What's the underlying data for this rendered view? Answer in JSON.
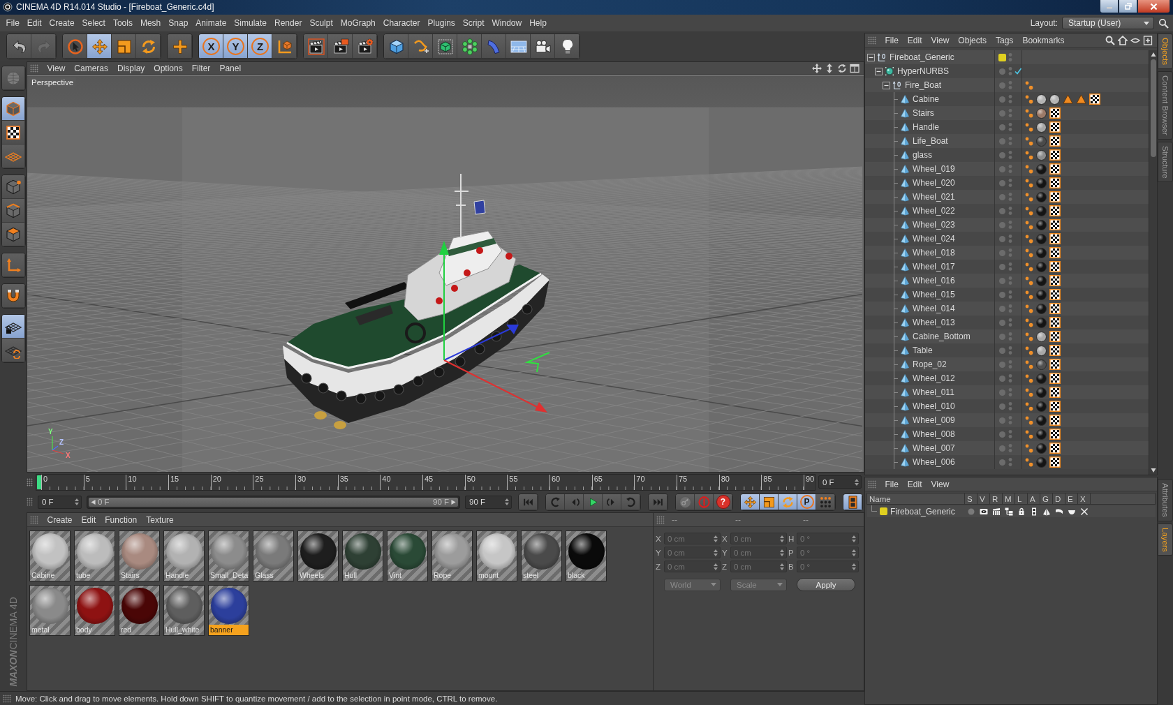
{
  "window": {
    "title": "CINEMA 4D R14.014 Studio - [Fireboat_Generic.c4d]"
  },
  "menu_bar": [
    "File",
    "Edit",
    "Create",
    "Select",
    "Tools",
    "Mesh",
    "Snap",
    "Animate",
    "Simulate",
    "Render",
    "Sculpt",
    "MoGraph",
    "Character",
    "Plugins",
    "Script",
    "Window",
    "Help"
  ],
  "layout": {
    "label": "Layout:",
    "value": "Startup (User)"
  },
  "toolbar": [
    [
      {
        "kind": "undo",
        "on": false
      },
      {
        "kind": "redo",
        "on": false
      }
    ],
    [
      {
        "kind": "select",
        "on": false
      },
      {
        "kind": "move",
        "on": true
      },
      {
        "kind": "scale",
        "on": false
      },
      {
        "kind": "rotate",
        "on": false
      }
    ],
    [
      {
        "kind": "add",
        "on": false
      }
    ],
    [
      {
        "kind": "axis",
        "label": "X",
        "on": true
      },
      {
        "kind": "axis",
        "label": "Y",
        "on": true
      },
      {
        "kind": "axis",
        "label": "Z",
        "on": true
      },
      {
        "kind": "coords",
        "on": false
      }
    ],
    [
      {
        "kind": "render_view",
        "on": false
      },
      {
        "kind": "render_pv",
        "on": false
      },
      {
        "kind": "render_settings",
        "on": false
      }
    ],
    [
      {
        "kind": "cube",
        "on": false
      },
      {
        "kind": "pen",
        "on": false
      },
      {
        "kind": "subdiv",
        "on": false
      },
      {
        "kind": "cloner",
        "on": false
      },
      {
        "kind": "deformer",
        "on": false
      },
      {
        "kind": "floor",
        "on": false
      },
      {
        "kind": "camera",
        "on": false
      },
      {
        "kind": "light",
        "on": false
      }
    ]
  ],
  "mode_toolbar": [
    [
      {
        "kind": "editable",
        "on": false
      }
    ],
    [
      {
        "kind": "model",
        "on": true
      },
      {
        "kind": "texture",
        "on": false
      },
      {
        "kind": "workplane",
        "on": false
      }
    ],
    [
      {
        "kind": "points",
        "on": false
      },
      {
        "kind": "edges",
        "on": false
      },
      {
        "kind": "polygons",
        "on": false
      }
    ],
    [
      {
        "kind": "axis_mode",
        "on": false
      }
    ],
    [
      {
        "kind": "snap",
        "on": false
      }
    ],
    [
      {
        "kind": "wp_lock",
        "on": true
      },
      {
        "kind": "wp_rotate",
        "on": false
      }
    ]
  ],
  "logo": {
    "brand": "MAXON",
    "product": "CINEMA 4D"
  },
  "viewport": {
    "menu": [
      "View",
      "Cameras",
      "Display",
      "Options",
      "Filter",
      "Panel"
    ],
    "camera": "Perspective",
    "axis_labels": [
      "Y",
      "X",
      "Z"
    ]
  },
  "timeline": {
    "ticks": [
      "0",
      "5",
      "10",
      "15",
      "20",
      "25",
      "30",
      "35",
      "40",
      "45",
      "50",
      "55",
      "60",
      "65",
      "70",
      "75",
      "80",
      "85",
      "90"
    ],
    "level": 0,
    "current_frame": "0 F",
    "start": "0 F",
    "range": {
      "start": "0 F",
      "end": "90 F",
      "level": 1
    },
    "end": "90 F"
  },
  "transport": [
    [
      {
        "kind": "to_start",
        "on": false
      }
    ],
    [
      {
        "kind": "prev_key",
        "on": false
      },
      {
        "kind": "step_back",
        "on": false
      },
      {
        "kind": "play",
        "on": false
      },
      {
        "kind": "step_forward",
        "on": false
      },
      {
        "kind": "next_key",
        "on": false
      }
    ],
    [
      {
        "kind": "to_end",
        "on": false
      }
    ],
    [
      {
        "kind": "key",
        "on": false
      },
      {
        "kind": "record",
        "on": false
      },
      {
        "kind": "question",
        "label": "?",
        "on": false
      }
    ],
    [
      {
        "kind": "move",
        "on": true
      },
      {
        "kind": "scale",
        "on": true
      },
      {
        "kind": "rotate",
        "on": true
      },
      {
        "kind": "param",
        "label": "P",
        "on": true
      },
      {
        "kind": "points_grid",
        "on": false
      }
    ],
    [
      {
        "kind": "film",
        "on": true
      }
    ]
  ],
  "materials": {
    "menu": [
      "Create",
      "Edit",
      "Function",
      "Texture"
    ],
    "items": [
      {
        "name": "Cabine",
        "color": "#c2c2c2",
        "selected": false
      },
      {
        "name": "tube",
        "color": "#bcbcbc",
        "selected": false
      },
      {
        "name": "Stairs",
        "color": "#a98a80",
        "selected": false
      },
      {
        "name": "Handle",
        "color": "#b2b2b2",
        "selected": false
      },
      {
        "name": "Small_Deta",
        "color": "#8c8c8c",
        "selected": false
      },
      {
        "name": "Glass",
        "color": "#7a7a7a",
        "selected": false
      },
      {
        "name": "Wheels",
        "color": "#1e1e1e",
        "selected": false
      },
      {
        "name": "Hull",
        "color": "#2e4034",
        "selected": false
      },
      {
        "name": "Vint",
        "color": "#2a4a36",
        "selected": false
      },
      {
        "name": "Rope",
        "color": "#9c9c9c",
        "selected": false
      },
      {
        "name": "mount",
        "color": "#c6c6c6",
        "selected": false
      },
      {
        "name": "steel",
        "color": "#4a4a4a",
        "selected": false
      },
      {
        "name": "black",
        "color": "#0a0a0a",
        "selected": false
      },
      {
        "name": "metal",
        "color": "#8a8a8a",
        "selected": false
      },
      {
        "name": "body",
        "color": "#8e1212",
        "selected": false
      },
      {
        "name": "red",
        "color": "#4a0606",
        "selected": false
      },
      {
        "name": "Hull_white",
        "color": "#5e5e5e",
        "selected": false
      },
      {
        "name": "banner",
        "color": "#2c3f9c",
        "selected": true
      }
    ]
  },
  "coordinates": {
    "headers": [
      "--",
      "--",
      "--"
    ],
    "disabled": true,
    "rows": [
      {
        "pos_axis": "X",
        "pos": "0 cm",
        "size_axis": "X",
        "size": "0 cm",
        "rot_axis": "H",
        "rot": "0 °"
      },
      {
        "pos_axis": "Y",
        "pos": "0 cm",
        "size_axis": "Y",
        "size": "0 cm",
        "rot_axis": "P",
        "rot": "0 °"
      },
      {
        "pos_axis": "Z",
        "pos": "0 cm",
        "size_axis": "Z",
        "size": "0 cm",
        "rot_axis": "B",
        "rot": "0 °"
      }
    ],
    "mode": "World",
    "transform": "Scale",
    "apply": "Apply"
  },
  "object_manager": {
    "menu": [
      "File",
      "Edit",
      "View",
      "Objects",
      "Tags",
      "Bookmarks"
    ],
    "tree": [
      {
        "name": "Fireboat_Generic",
        "kind": "null",
        "color": "#e0d020",
        "expanded": true,
        "children": [
          {
            "name": "HyperNURBS",
            "kind": "nurbs",
            "enabled": true,
            "expanded": true,
            "children": [
              {
                "name": "Fire_Boat",
                "kind": "null",
                "expanded": true,
                "tags": [
                  {
                    "kind": "phong"
                  }
                ],
                "children": [
                  {
                    "name": "Cabine",
                    "kind": "polygon",
                    "tags": [
                      {
                        "kind": "phong"
                      },
                      {
                        "kind": "material",
                        "color": "#b4b4b4"
                      },
                      {
                        "kind": "material",
                        "color": "#b4b4b4"
                      },
                      {
                        "kind": "selection"
                      },
                      {
                        "kind": "selection"
                      },
                      {
                        "kind": "uvw"
                      }
                    ]
                  },
                  {
                    "name": "Stairs",
                    "kind": "polygon",
                    "tags": [
                      {
                        "kind": "phong"
                      },
                      {
                        "kind": "material",
                        "color": "#9c7a68"
                      },
                      {
                        "kind": "uvw"
                      }
                    ]
                  },
                  {
                    "name": "Handle",
                    "kind": "polygon",
                    "tags": [
                      {
                        "kind": "phong"
                      },
                      {
                        "kind": "material",
                        "color": "#a6a6a6"
                      },
                      {
                        "kind": "uvw"
                      }
                    ]
                  },
                  {
                    "name": "Life_Boat",
                    "kind": "polygon",
                    "tags": [
                      {
                        "kind": "phong"
                      },
                      {
                        "kind": "material",
                        "color": "#4a4a4a"
                      },
                      {
                        "kind": "uvw"
                      }
                    ]
                  },
                  {
                    "name": "glass",
                    "kind": "polygon",
                    "tags": [
                      {
                        "kind": "phong"
                      },
                      {
                        "kind": "material",
                        "color": "#8c8c8c"
                      },
                      {
                        "kind": "uvw"
                      }
                    ]
                  },
                  {
                    "name": "Wheel_019",
                    "kind": "polygon",
                    "tags": [
                      {
                        "kind": "phong"
                      },
                      {
                        "kind": "material",
                        "color": "#141414"
                      },
                      {
                        "kind": "uvw"
                      }
                    ]
                  },
                  {
                    "name": "Wheel_020",
                    "kind": "polygon",
                    "tags": [
                      {
                        "kind": "phong"
                      },
                      {
                        "kind": "material",
                        "color": "#141414"
                      },
                      {
                        "kind": "uvw"
                      }
                    ]
                  },
                  {
                    "name": "Wheel_021",
                    "kind": "polygon",
                    "tags": [
                      {
                        "kind": "phong"
                      },
                      {
                        "kind": "material",
                        "color": "#141414"
                      },
                      {
                        "kind": "uvw"
                      }
                    ]
                  },
                  {
                    "name": "Wheel_022",
                    "kind": "polygon",
                    "tags": [
                      {
                        "kind": "phong"
                      },
                      {
                        "kind": "material",
                        "color": "#141414"
                      },
                      {
                        "kind": "uvw"
                      }
                    ]
                  },
                  {
                    "name": "Wheel_023",
                    "kind": "polygon",
                    "tags": [
                      {
                        "kind": "phong"
                      },
                      {
                        "kind": "material",
                        "color": "#141414"
                      },
                      {
                        "kind": "uvw"
                      }
                    ]
                  },
                  {
                    "name": "Wheel_024",
                    "kind": "polygon",
                    "tags": [
                      {
                        "kind": "phong"
                      },
                      {
                        "kind": "material",
                        "color": "#141414"
                      },
                      {
                        "kind": "uvw"
                      }
                    ]
                  },
                  {
                    "name": "Wheel_018",
                    "kind": "polygon",
                    "tags": [
                      {
                        "kind": "phong"
                      },
                      {
                        "kind": "material",
                        "color": "#141414"
                      },
                      {
                        "kind": "uvw"
                      }
                    ]
                  },
                  {
                    "name": "Wheel_017",
                    "kind": "polygon",
                    "tags": [
                      {
                        "kind": "phong"
                      },
                      {
                        "kind": "material",
                        "color": "#141414"
                      },
                      {
                        "kind": "uvw"
                      }
                    ]
                  },
                  {
                    "name": "Wheel_016",
                    "kind": "polygon",
                    "tags": [
                      {
                        "kind": "phong"
                      },
                      {
                        "kind": "material",
                        "color": "#141414"
                      },
                      {
                        "kind": "uvw"
                      }
                    ]
                  },
                  {
                    "name": "Wheel_015",
                    "kind": "polygon",
                    "tags": [
                      {
                        "kind": "phong"
                      },
                      {
                        "kind": "material",
                        "color": "#141414"
                      },
                      {
                        "kind": "uvw"
                      }
                    ]
                  },
                  {
                    "name": "Wheel_014",
                    "kind": "polygon",
                    "tags": [
                      {
                        "kind": "phong"
                      },
                      {
                        "kind": "material",
                        "color": "#141414"
                      },
                      {
                        "kind": "uvw"
                      }
                    ]
                  },
                  {
                    "name": "Wheel_013",
                    "kind": "polygon",
                    "tags": [
                      {
                        "kind": "phong"
                      },
                      {
                        "kind": "material",
                        "color": "#141414"
                      },
                      {
                        "kind": "uvw"
                      }
                    ]
                  },
                  {
                    "name": "Cabine_Bottom",
                    "kind": "polygon",
                    "tags": [
                      {
                        "kind": "phong"
                      },
                      {
                        "kind": "material",
                        "color": "#a8a8a8"
                      },
                      {
                        "kind": "uvw"
                      }
                    ]
                  },
                  {
                    "name": "Table",
                    "kind": "polygon",
                    "tags": [
                      {
                        "kind": "phong"
                      },
                      {
                        "kind": "material",
                        "color": "#a8a8a8"
                      },
                      {
                        "kind": "uvw"
                      }
                    ]
                  },
                  {
                    "name": "Rope_02",
                    "kind": "polygon",
                    "tags": [
                      {
                        "kind": "phong"
                      },
                      {
                        "kind": "material",
                        "color": "#505050"
                      },
                      {
                        "kind": "uvw"
                      }
                    ]
                  },
                  {
                    "name": "Wheel_012",
                    "kind": "polygon",
                    "tags": [
                      {
                        "kind": "phong"
                      },
                      {
                        "kind": "material",
                        "color": "#141414"
                      },
                      {
                        "kind": "uvw"
                      }
                    ]
                  },
                  {
                    "name": "Wheel_011",
                    "kind": "polygon",
                    "tags": [
                      {
                        "kind": "phong"
                      },
                      {
                        "kind": "material",
                        "color": "#141414"
                      },
                      {
                        "kind": "uvw"
                      }
                    ]
                  },
                  {
                    "name": "Wheel_010",
                    "kind": "polygon",
                    "tags": [
                      {
                        "kind": "phong"
                      },
                      {
                        "kind": "material",
                        "color": "#141414"
                      },
                      {
                        "kind": "uvw"
                      }
                    ]
                  },
                  {
                    "name": "Wheel_009",
                    "kind": "polygon",
                    "tags": [
                      {
                        "kind": "phong"
                      },
                      {
                        "kind": "material",
                        "color": "#141414"
                      },
                      {
                        "kind": "uvw"
                      }
                    ]
                  },
                  {
                    "name": "Wheel_008",
                    "kind": "polygon",
                    "tags": [
                      {
                        "kind": "phong"
                      },
                      {
                        "kind": "material",
                        "color": "#141414"
                      },
                      {
                        "kind": "uvw"
                      }
                    ]
                  },
                  {
                    "name": "Wheel_007",
                    "kind": "polygon",
                    "tags": [
                      {
                        "kind": "phong"
                      },
                      {
                        "kind": "material",
                        "color": "#141414"
                      },
                      {
                        "kind": "uvw"
                      }
                    ]
                  },
                  {
                    "name": "Wheel_006",
                    "kind": "polygon",
                    "tags": [
                      {
                        "kind": "phong"
                      },
                      {
                        "kind": "material",
                        "color": "#141414"
                      },
                      {
                        "kind": "uvw"
                      }
                    ]
                  }
                ]
              }
            ]
          }
        ]
      }
    ]
  },
  "side_tabs": [
    {
      "label": "Objects",
      "selected": true
    },
    {
      "label": "Content Browser",
      "selected": false
    },
    {
      "label": "Structure",
      "selected": false
    }
  ],
  "layer_manager": {
    "menu": [
      "File",
      "Edit",
      "View"
    ],
    "columns": [
      "Name",
      "S",
      "V",
      "R",
      "M",
      "L",
      "A",
      "G",
      "D",
      "E",
      "X"
    ],
    "rows": [
      {
        "name": "Fireboat_Generic",
        "color": "#e0d020",
        "flags": [
          {
            "kind": "solo",
            "on": false
          },
          {
            "kind": "view",
            "on": true
          },
          {
            "kind": "render",
            "on": true
          },
          {
            "kind": "manager",
            "on": true
          },
          {
            "kind": "lock",
            "on": true
          },
          {
            "kind": "animation",
            "on": true
          },
          {
            "kind": "generators",
            "on": true
          },
          {
            "kind": "deformers",
            "on": true
          },
          {
            "kind": "expressions",
            "on": true
          },
          {
            "kind": "xrefs",
            "on": true
          }
        ]
      }
    ]
  },
  "side_tabs_lower": [
    {
      "label": "Attributes",
      "selected": false
    },
    {
      "label": "Layers",
      "selected": true
    }
  ],
  "status_bar": "Move: Click and drag to move elements. Hold down SHIFT to quantize movement / add to the selection in point mode, CTRL to remove."
}
